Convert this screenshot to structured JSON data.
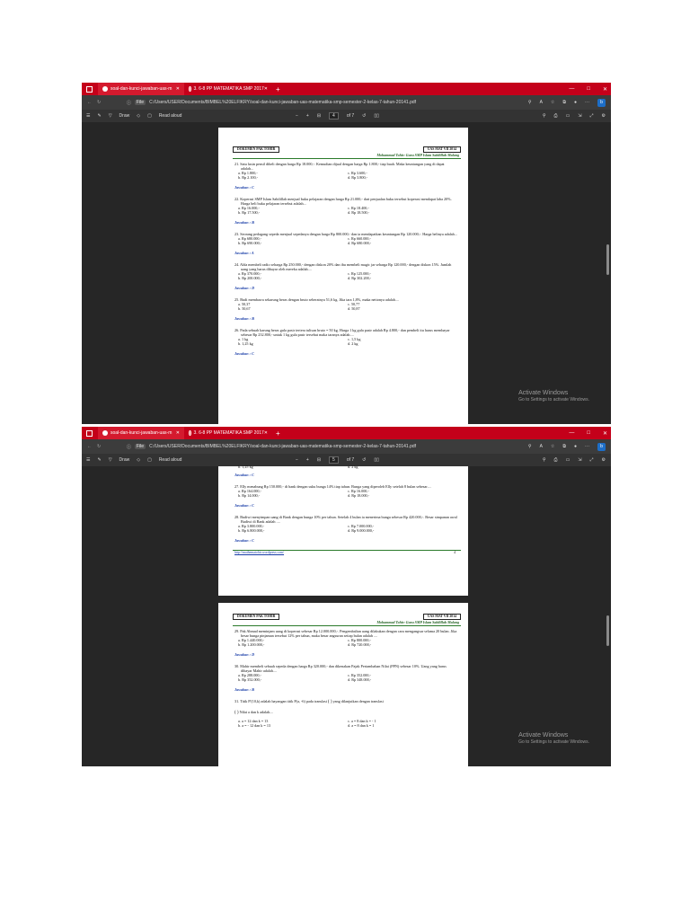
{
  "browser": {
    "tab_active": "soal-dan-kunci-jawaban-uas-m",
    "tab_other": "3. 6-8 PP MATEMATIKA SMP 2017",
    "address": "C:/Users/USER/Documents/BIMBEL%20ELFIKRY/soal-dan-kunci-jawaban-uas-matematika-smp-semester-2-kelas-7-tahun-20141.pdf",
    "file_label": "File",
    "draw_label": "Draw",
    "read_aloud": "Read aloud",
    "page_total": "of 7",
    "page1_current": "4",
    "page2_current": "5"
  },
  "watermark": {
    "title": "Activate Windows",
    "subtitle": "Go to Settings to activate Windows."
  },
  "doc_header": {
    "left": "DOKUMEN PAK TOHIR",
    "right": "UAS MAT VII 2014",
    "author": "Mohammad Tohir: Guru SMP Islam Sabilillah Malang"
  },
  "page4": {
    "questions": [
      {
        "q": "21.  Satu lusin pensil dibeli dengan harga Rp 18.000,-. Kemudian dijual dengan harga Rp 1.800,- tiap buah. Maka keuntungan yang di dapat adalah...",
        "a": "a.  Rp 1.800,-",
        "b": "b.  Rp 2.100,-",
        "c": "c.  Rp 3.600,-",
        "d": "d.  Rp 3.800,-",
        "ans": "Jawaban : C"
      },
      {
        "q": "22.  Koperasi SMP Islam Sabilillah menjual buku pelajaran dengan harga Rp 21.000,- dari penjualan buku tersebut koperasi mendapat laba 20%. Harga beli buku pelajaran tersebut adalah...",
        "a": "a.  Rp 16.000,-",
        "b": "b.  Rp 17.500,-",
        "c": "c.  Rp 18.400,-",
        "d": "d.  Rp 18.500,-",
        "ans": "Jawaban : B"
      },
      {
        "q": "23.  Seorang pedagang sepeda menjual sepedanya dengan harga Rp 800.000,- dan ia mendapatkan keuntungan Rp 120.000,-. Harga belinya adalah...",
        "a": "a.  Rp 680.000,-",
        "b": "b.  Rp 690.000,-",
        "c": "c.  Rp 660.000,-",
        "d": "d.  Rp 680.000,-",
        "ans": "Jawaban : A"
      },
      {
        "q": "24.  Alda membeli radio seharga Rp 250.000,- dengan diskon 20% dan ibu membeli magic jar seharga Rp 120.000,- dengan diskon 15%. Jumlah uang yang harus dibayar oleh mereka adalah....",
        "a": "a.  Rp 370.000,-",
        "b": "b.  Rp 200.000,-",
        "c": "c.  Rp 125.000,-",
        "d": "d.  Rp 302.200,-",
        "ans": "Jawaban : D"
      },
      {
        "q": "25.  Budi membawa sekarung beras dengan bruto seberatnya 51,6 kg. Jika tara 1,8%, maka nettonya adalah....",
        "a": "a.  50,37",
        "b": "b.  50,67",
        "c": "c.  50,77",
        "d": "d.  50,87",
        "ans": "Jawaban : B"
      },
      {
        "q": "26.  Pada sebuah karung beras gula pasir tertera tulisan bruto = 50 kg. Harga 1 kg gula pasir adalah Rp 4.800,- dan pembeli itu harus membayar sebesar Rp 232.800,- untuk 1 kg gula pasir tersebut maka taranya adalah....",
        "a": "a.  1 kg",
        "b": "b.  1,25 kg",
        "c": "c.  1,5 kg",
        "d": "d.  2 kg",
        "ans": "Jawaban : C"
      }
    ]
  },
  "page4b": {
    "cut_top": "b.  1,25 kg",
    "cut_top_right": "d.  2 kg",
    "first_ans": "Jawaban : C",
    "questions": [
      {
        "q": "27.  Elly menabung Rp 150.000,- di bank dengan suku bunga 14% tiap tahun. Bunga yang diperoleh Elly setelah 8 bulan sebesar....",
        "a": "a.  Rp 164.000,-",
        "b": "b.  Rp 14.000,-",
        "c": "c.  Rp 16.000,-",
        "d": "d.  Rp 18.000,-",
        "ans": "Jawaban : C"
      },
      {
        "q": "28.  Budiwi menyimpan uang di Bank dengan bunga 10% per tahun. Setelah 4 bulan ia menerima bunga sebesar Rp 420.000,-. Besar simpanan awal Budiwi di Bank adalah ....",
        "a": "a.  Rp 3.800.000,-",
        "b": "b.  Rp 6.800.000,-",
        "c": "c.  Rp 7.000.000,-",
        "d": "d.  Rp 9.000.000,-",
        "ans": "Jawaban : C"
      }
    ],
    "footer_link": "http://mathematohir.wordpress.com/",
    "footer_page": "4"
  },
  "page5": {
    "questions": [
      {
        "q": "29.  Pak Ahmad meminjam uang di koperasi sebesar Rp 12.000.000,-. Pengembalian uang dilakukan dengan cara mengangsur selama 20 bulan. Jika besar bunga pinjaman tersebut 12% per tahun, maka besar angsuran setiap bulan adalah ....",
        "a": "a.  Rp 1.440.000,-",
        "b": "b.  Rp 1.200.000,-",
        "c": "c.  Rp 800.000,-",
        "d": "d.  Rp 720.000,-",
        "ans": "Jawaban : D"
      },
      {
        "q": "30.  Mahir membeli sebuah sepeda dengan harga Rp 320.000,- dan dikenakan Pajak Pertambahan Nilai (PPN) sebesar 10%. Uang yang harus dibayar Mahir adalah....",
        "a": "a.  Rp 288.000,-",
        "b": "b.  Rp 352.000,-",
        "c": "c.  Rp 352.000,-",
        "d": "d.  Rp 348.000,-",
        "ans": "Jawaban : B"
      }
    ],
    "q31": "31.  Titik P'(10,k) adalah bayangan titik P(a, -6) pada translasi",
    "q31_tail": "yang dilanjutkan dengan translasi",
    "q31_line2": "Nilai a dan k adalah....",
    "q31_a": "a.     a = 12 dan k = 13",
    "q31_b": "b.     a = - 12 dan k = 13",
    "q31_c": "c. a = 8 dan k = - 1",
    "q31_d": "d. a = 8 dan k = 1"
  }
}
